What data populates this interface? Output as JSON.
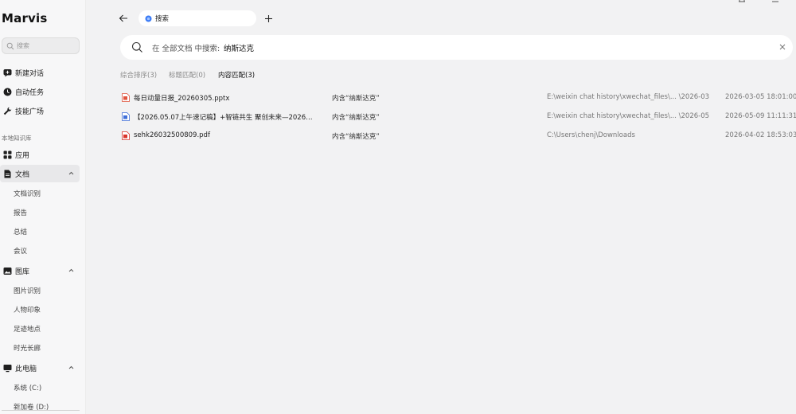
{
  "app": {
    "name": "Marvis"
  },
  "sidebar": {
    "search_placeholder": "搜索",
    "top_items": [
      {
        "label": "新建对话",
        "icon": "new-chat-icon"
      },
      {
        "label": "自动任务",
        "icon": "clock-icon"
      },
      {
        "label": "技能广场",
        "icon": "wrench-icon"
      }
    ],
    "section_label": "本地知识库",
    "apps": {
      "label": "应用",
      "icon": "grid-icon"
    },
    "docs": {
      "label": "文档",
      "icon": "doc-icon",
      "children": [
        "文档识别",
        "报告",
        "总结",
        "会议"
      ]
    },
    "gallery": {
      "label": "图库",
      "icon": "image-icon",
      "children": [
        "图片识别",
        "人物印象",
        "足迹地点",
        "时光长廊"
      ]
    },
    "computer": {
      "label": "此电脑",
      "icon": "monitor-icon",
      "children": [
        "系统 (C:)",
        "新加卷 (D:)"
      ]
    }
  },
  "main": {
    "tab_label": "搜索",
    "search": {
      "prefix": "在 全部文档 中搜索:",
      "query": "纳斯达克"
    },
    "filters": [
      {
        "label": "综合排序(3)",
        "active": false
      },
      {
        "label": "标题匹配(0)",
        "active": false
      },
      {
        "label": "内容匹配(3)",
        "active": true
      }
    ],
    "results": [
      {
        "type": "pptx",
        "name": "每日动量日报_20260305.pptx",
        "match": "内含“纳斯达克”",
        "path": "E:\\weixin chat history\\xwechat_files\\... \\2026-03",
        "time": "2026-03-05 18:01:00"
      },
      {
        "type": "docx",
        "name": "【2026.05.07上午速记稿】+智链共生 聚创未来—2026…",
        "match": "内含“纳斯达克”",
        "path": "E:\\weixin chat history\\xwechat_files\\... \\2026-05",
        "time": "2026-05-09 11:11:31"
      },
      {
        "type": "pdf",
        "name": "sehk26032500809.pdf",
        "match": "内含“纳斯达克”",
        "path": "C:\\Users\\chenj\\Downloads",
        "time": "2026-04-02 18:53:03"
      }
    ]
  },
  "colors": {
    "pptx_icon": "#e0533d",
    "docx_icon": "#3f6fd8",
    "pdf_icon": "#d9342b",
    "accent": "#3a7bf6"
  }
}
